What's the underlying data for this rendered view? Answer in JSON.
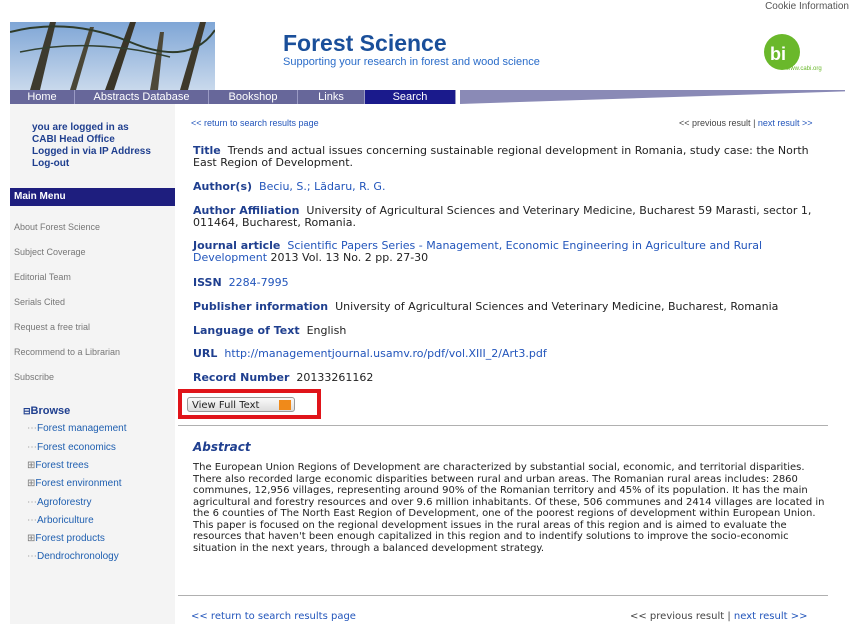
{
  "cookie": "Cookie Information",
  "site": {
    "title": "Forest Science",
    "subtitle": "Supporting your research in forest and wood science",
    "logo_text": "www.cabi.org"
  },
  "nav": [
    "Home",
    "Abstracts Database",
    "Bookshop",
    "Links",
    "Search"
  ],
  "login": {
    "line1": "you are logged in as",
    "line2": "CABI Head Office",
    "line3": "Logged in via IP Address",
    "logout": "Log-out"
  },
  "main_menu": {
    "heading": "Main Menu",
    "items": [
      "About Forest Science",
      "Subject Coverage",
      "Editorial Team",
      "Serials Cited",
      "Request a free trial",
      "Recommend to a Librarian",
      "Subscribe"
    ]
  },
  "browse": {
    "label": "Browse",
    "toggle": "⊟",
    "items": [
      {
        "prefix": "⋯",
        "label": "Forest management"
      },
      {
        "prefix": "⋯",
        "label": "Forest economics"
      },
      {
        "prefix": "⊞",
        "label": "Forest trees"
      },
      {
        "prefix": "⊞",
        "label": "Forest environment"
      },
      {
        "prefix": "⋯",
        "label": "Agroforestry"
      },
      {
        "prefix": "⋯",
        "label": "Arboriculture"
      },
      {
        "prefix": "⊞",
        "label": "Forest products"
      },
      {
        "prefix": "⋯",
        "label": "Dendrochronology"
      }
    ]
  },
  "top_links": {
    "back": "<< return to search results page",
    "prev": "<< previous result",
    "sep": "|",
    "next": "next result >>"
  },
  "record": {
    "title_label": "Title",
    "title": "Trends and actual issues concerning sustainable regional development in Romania, study case: the North East Region of Development.",
    "authors_label": "Author(s)",
    "authors": "Beciu, S.; Lădaru, R. G.",
    "affil_label": "Author Affiliation",
    "affil": "University of Agricultural Sciences and Veterinary Medicine, Bucharest 59 Marasti, sector 1, 011464, Bucharest, Romania.",
    "journal_label": "Journal article",
    "journal": "Scientific Papers Series - Management, Economic Engineering in Agriculture and Rural Development",
    "journal_tail": " 2013 Vol. 13 No. 2 pp. 27-30",
    "issn_label": "ISSN",
    "issn": "2284-7995",
    "publisher_label": "Publisher information",
    "publisher": "University of Agricultural Sciences and Veterinary Medicine, Bucharest, Romania",
    "lang_label": "Language of Text",
    "lang": "English",
    "url_label": "URL",
    "url": "http://managementjournal.usamv.ro/pdf/vol.XIII_2/Art3.pdf",
    "recnum_label": "Record Number",
    "recnum": "20133261162"
  },
  "view_full_text": "View Full Text",
  "abstract": {
    "heading": "Abstract",
    "text": "The European Union Regions of Development are characterized by substantial social, economic, and territorial disparities. There also recorded large economic disparities between rural and urban areas. The Romanian rural areas includes: 2860 communes, 12,956 villages, representing around 90% of the Romanian territory and 45% of its population. It has the main agricultural and forestry resources and over 9.6 million inhabitants. Of these, 506 communes and 2414 villages are located in the 6 counties of The North East Region of Development, one of the poorest regions of development within European Union. This paper is focused on the regional development issues in the rural areas of this region and is aimed to evaluate the resources that haven't been enough capitalized in this region and to indentify solutions to improve the socio-economic situation in the next years, through a balanced development strategy."
  },
  "colors": {
    "nav_bg": "#67679a",
    "nav_active": "#1a1a8c",
    "title_blue": "#1a4f9a",
    "highlight_red": "#e0141a",
    "cabi_green": "#6ab82b"
  }
}
